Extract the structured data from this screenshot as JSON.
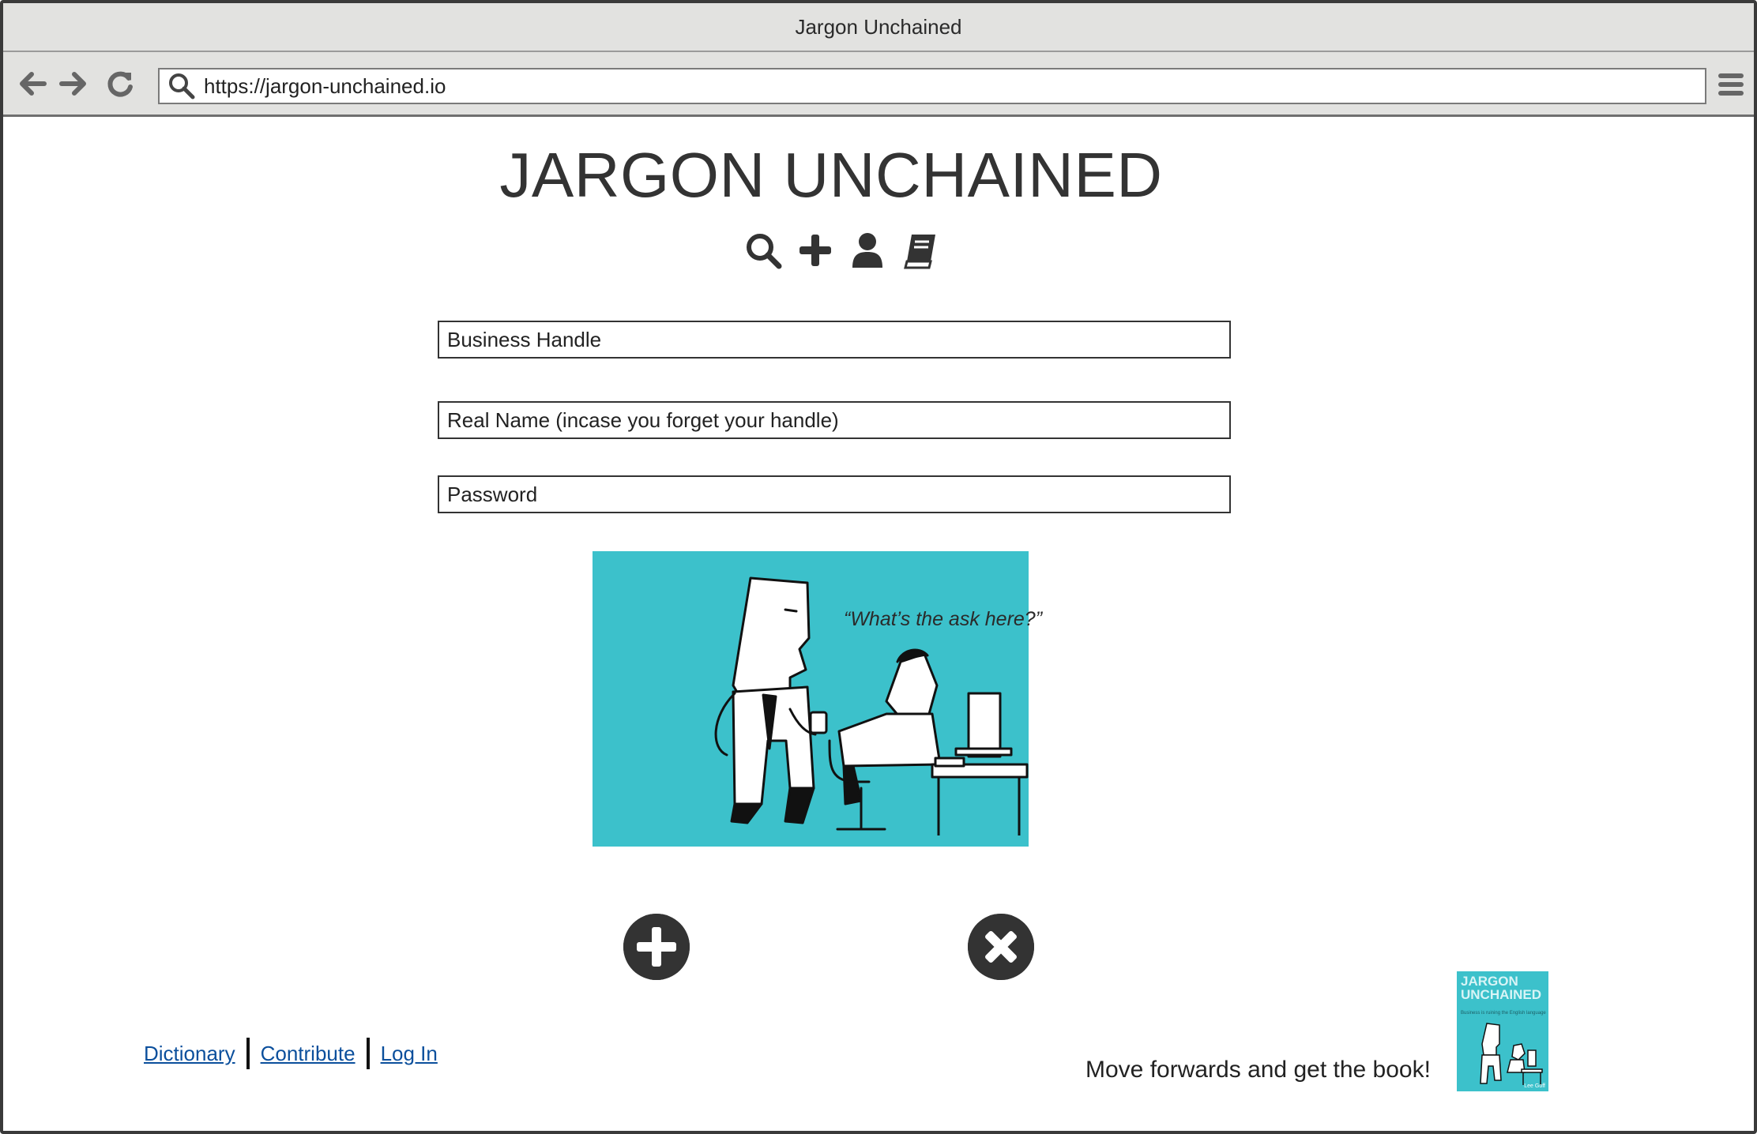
{
  "window": {
    "title": "Jargon Unchained"
  },
  "browser": {
    "url": "https://jargon-unchained.io"
  },
  "header": {
    "site_title": "JARGON UNCHAINED",
    "nav_icons": [
      "search-icon",
      "plus-icon",
      "user-icon",
      "book-icon"
    ]
  },
  "form": {
    "business_handle_placeholder": "Business Handle",
    "real_name_placeholder": "Real Name (incase you forget your handle)",
    "password_placeholder": "Password"
  },
  "illustration": {
    "quote": "“What’s the ask here?”"
  },
  "actions": {
    "add_icon": "plus-circle-icon",
    "cancel_icon": "times-circle-icon"
  },
  "footer": {
    "links": [
      "Dictionary",
      "Contribute",
      "Log In"
    ],
    "promo_text": "Move forwards and get the book!",
    "book": {
      "title": "JARGON UNCHAINED",
      "subtitle": "Business is ruining the English language",
      "author": "Lee Goff"
    }
  },
  "colors": {
    "accent": "#3cc1cb",
    "icon": "#333333",
    "link": "#0b4f9c",
    "chrome": "#e2e2e0"
  }
}
